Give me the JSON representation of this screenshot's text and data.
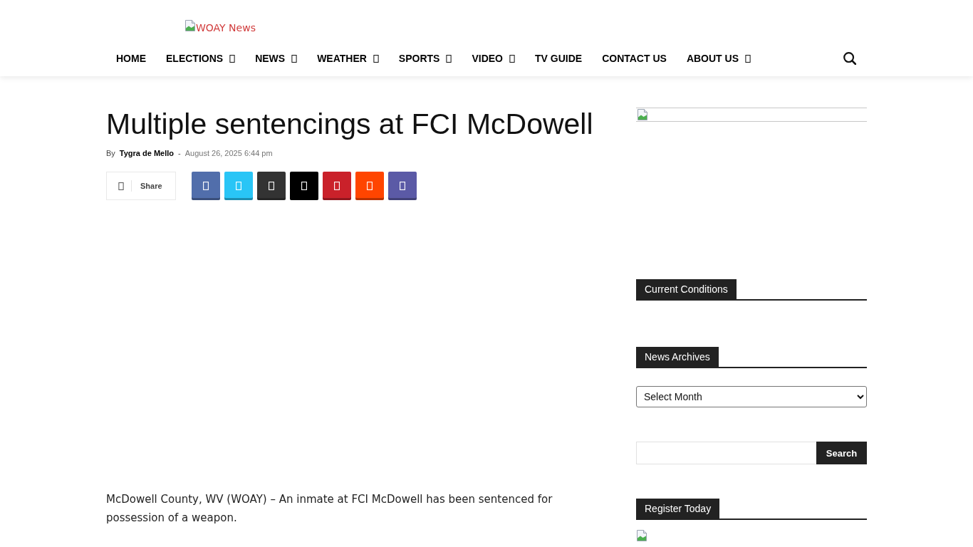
{
  "header": {
    "logo": {
      "alt_text": "WOAY News"
    },
    "nav": [
      {
        "label": "HOME",
        "dropdown": false
      },
      {
        "label": "ELECTIONS",
        "dropdown": true
      },
      {
        "label": "NEWS",
        "dropdown": true
      },
      {
        "label": "WEATHER",
        "dropdown": true
      },
      {
        "label": "SPORTS",
        "dropdown": true
      },
      {
        "label": "VIDEO",
        "dropdown": true
      },
      {
        "label": "TV GUIDE",
        "dropdown": false
      },
      {
        "label": "CONTACT US",
        "dropdown": false
      },
      {
        "label": "ABOUT US",
        "dropdown": true
      }
    ]
  },
  "article": {
    "title": "Multiple sentencings at FCI McDowell",
    "byline": {
      "prefix": "By",
      "author": "Tygra de Mello",
      "separator": "-",
      "date": "August 26, 2025 6:44 pm"
    },
    "share": {
      "label": "Share",
      "buttons": [
        {
          "color": "#516eab"
        },
        {
          "color": "#29c5f6"
        },
        {
          "color": "#333333"
        },
        {
          "color": "#000000"
        },
        {
          "color": "#ca212a"
        },
        {
          "color": "#ff4500"
        },
        {
          "color": "#5b5aa6"
        }
      ]
    },
    "paragraphs": [
      "McDowell County, WV (WOAY) – An inmate at FCI McDowell has been sentenced for possession of a weapon."
    ]
  },
  "sidebar": [
    {
      "kind": "banner"
    },
    {
      "kind": "weather",
      "title": "Current Conditions"
    },
    {
      "kind": "archive",
      "title": "News Archives",
      "select": "Select Month"
    },
    {
      "kind": "search",
      "button": "Search"
    },
    {
      "kind": "image",
      "title": "Register Today"
    }
  ]
}
